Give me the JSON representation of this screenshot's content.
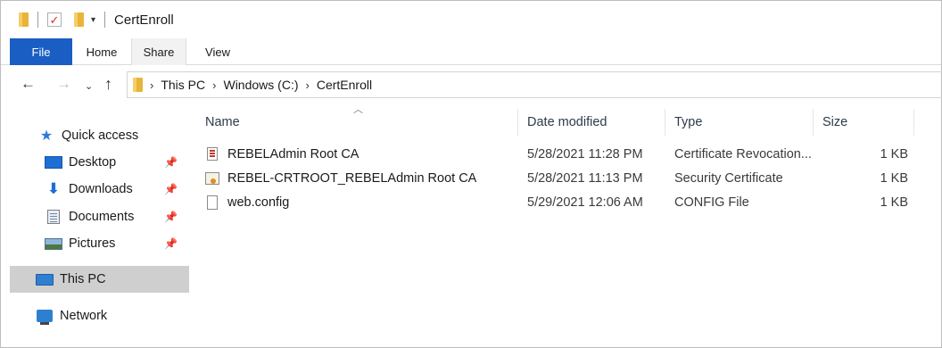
{
  "window": {
    "title": "CertEnroll"
  },
  "ribbon": {
    "tabs": [
      {
        "label": "File"
      },
      {
        "label": "Home"
      },
      {
        "label": "Share"
      },
      {
        "label": "View"
      }
    ]
  },
  "address": {
    "crumbs": [
      "This PC",
      "Windows (C:)",
      "CertEnroll"
    ]
  },
  "sidebar": {
    "items": [
      {
        "label": "Quick access",
        "icon": "star-icon"
      },
      {
        "label": "Desktop",
        "icon": "desktop-icon",
        "pinned": true
      },
      {
        "label": "Downloads",
        "icon": "download-arrow-icon",
        "pinned": true
      },
      {
        "label": "Documents",
        "icon": "documents-icon",
        "pinned": true
      },
      {
        "label": "Pictures",
        "icon": "pictures-icon",
        "pinned": true
      },
      {
        "label": "This PC",
        "icon": "computer-icon",
        "selected": true
      },
      {
        "label": "Network",
        "icon": "network-icon"
      }
    ]
  },
  "columns": {
    "name": "Name",
    "date": "Date modified",
    "type": "Type",
    "size": "Size"
  },
  "files": [
    {
      "name": "REBELAdmin Root CA",
      "date": "5/28/2021 11:28 PM",
      "type": "Certificate Revocation...",
      "size": "1 KB",
      "icon": "crl-file-icon"
    },
    {
      "name": "REBEL-CRTROOT_REBELAdmin Root CA",
      "date": "5/28/2021 11:13 PM",
      "type": "Security Certificate",
      "size": "1 KB",
      "icon": "certificate-file-icon"
    },
    {
      "name": "web.config",
      "date": "5/29/2021 12:06 AM",
      "type": "CONFIG File",
      "size": "1 KB",
      "icon": "config-file-icon"
    }
  ],
  "colors": {
    "file_tab": "#1a5ec3",
    "selected_nav": "#cfcfcf",
    "folder": "#e8b43a",
    "accent_icon": "#2e7bd6"
  }
}
